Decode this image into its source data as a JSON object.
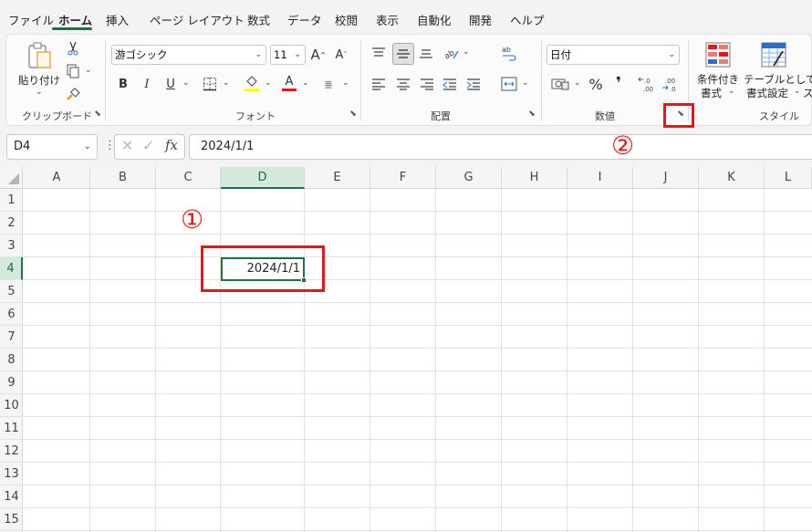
{
  "menu": {
    "tabs": [
      "ファイル",
      "ホーム",
      "挿入",
      "ページ レイアウト",
      "数式",
      "データ",
      "校閲",
      "表示",
      "自動化",
      "開発",
      "ヘルプ"
    ],
    "active_tab": "ホーム"
  },
  "ribbon": {
    "clipboard": {
      "paste_label": "貼り付け",
      "group_label": "クリップボード"
    },
    "font": {
      "font_name": "游ゴシック",
      "font_size": "11",
      "increase_label": "A",
      "decrease_label": "A",
      "bold": "B",
      "italic": "I",
      "underline": "U",
      "font_color_letter": "A",
      "phonetic": "亜",
      "group_label": "フォント",
      "fill_color": "#ffff00",
      "font_color": "#e0191d"
    },
    "alignment": {
      "group_label": "配置"
    },
    "number": {
      "format": "日付",
      "percent": "%",
      "comma": "❜",
      "group_label": "数値"
    },
    "styles": {
      "conditional_line1": "条件付き",
      "conditional_line2": "書式",
      "table_line1": "テーブルとして",
      "table_line2": "書式設定",
      "cell_styles_partial": "ス",
      "group_label": "スタイル"
    }
  },
  "formula_bar": {
    "name_box": "D4",
    "fx": "fx",
    "formula": "2024/1/1"
  },
  "sheet": {
    "columns": [
      "A",
      "B",
      "C",
      "D",
      "E",
      "F",
      "G",
      "H",
      "I",
      "J",
      "K",
      "L"
    ],
    "rows": [
      "1",
      "2",
      "3",
      "4",
      "5",
      "6",
      "7",
      "8",
      "9",
      "10",
      "11",
      "12",
      "13",
      "14",
      "15"
    ],
    "active_cell": "D4",
    "active_cell_value": "2024/1/1"
  },
  "annotations": {
    "marker_1": "①",
    "marker_2": "②",
    "highlight_color": "#e0191d"
  }
}
